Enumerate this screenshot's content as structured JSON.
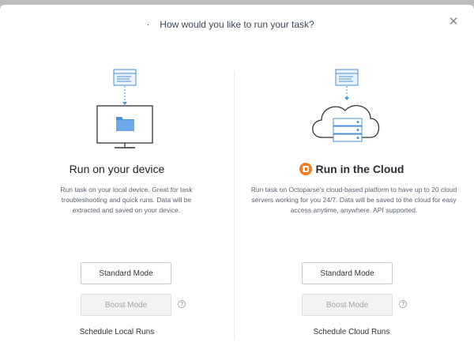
{
  "dialog": {
    "title": "How would you like to run your task?",
    "close_icon": "close-icon"
  },
  "left": {
    "heading": "Run on your device",
    "description": "Run task on your local device. Great for task troubleshooting and quick runs. Data will be extracted and saved on your device.",
    "standard_label": "Standard Mode",
    "boost_label": "Boost Mode",
    "schedule_label": "Schedule Local Runs",
    "help_icon": "help-icon"
  },
  "right": {
    "heading": "Run in the Cloud",
    "description": "Run task on Octoparse's cloud-based platform to have up to 20 cloud servers working for you 24/7. Data will be saved to the cloud for easy access anytime, anywhere. API supported.",
    "standard_label": "Standard Mode",
    "boost_label": "Boost Mode",
    "schedule_label": "Schedule Cloud Runs",
    "help_icon": "help-icon"
  },
  "colors": {
    "brand_orange": "#f47b20",
    "illustration_blue": "#4a90d9",
    "disabled_gray": "#f3f3f3"
  }
}
